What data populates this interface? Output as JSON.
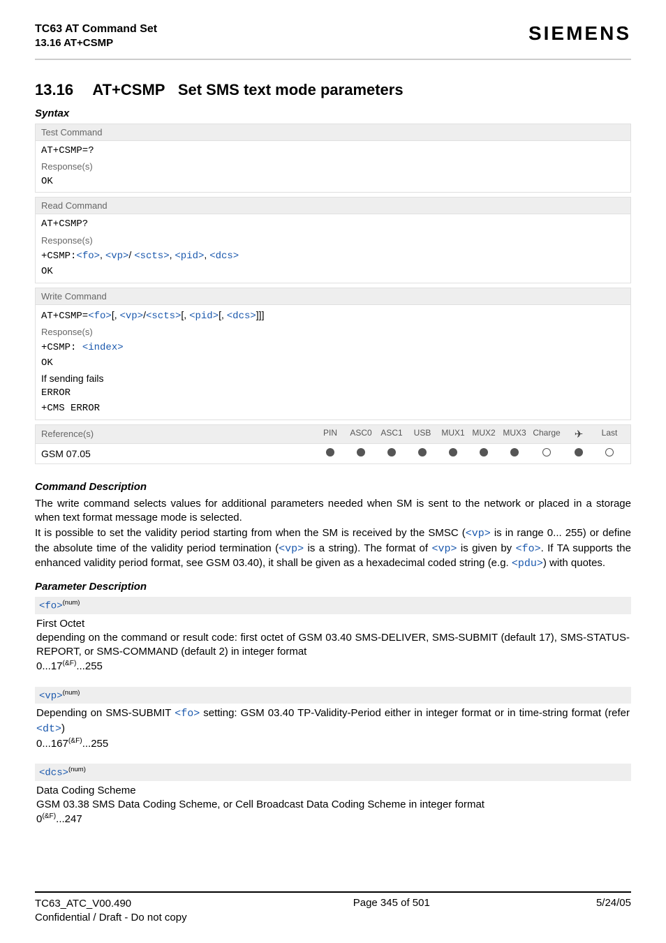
{
  "header": {
    "doc_title": "TC63 AT Command Set",
    "section_ref": "13.16 AT+CSMP",
    "brand": "SIEMENS"
  },
  "title": {
    "number": "13.16",
    "name": "AT+CSMP",
    "desc": "Set SMS text mode parameters"
  },
  "syntax": {
    "label": "Syntax",
    "test": {
      "head": "Test Command",
      "cmd": "AT+CSMP=?",
      "resp_label": "Response(s)",
      "resp": "OK"
    },
    "read": {
      "head": "Read Command",
      "cmd": "AT+CSMP?",
      "resp_label": "Response(s)",
      "resp_prefix": "+CSMP:",
      "p_fo": "<fo>",
      "p_vp": "<vp>",
      "p_scts": "<scts>",
      "p_pid": "<pid>",
      "p_dcs": "<dcs>",
      "resp_ok": "OK"
    },
    "write": {
      "head": "Write Command",
      "cmd_prefix": "AT+CSMP=",
      "p_fo": "<fo>",
      "p_vp": "<vp>",
      "p_scts": "<scts>",
      "p_pid": "<pid>",
      "p_dcs": "<dcs>",
      "resp_label": "Response(s)",
      "resp_line1a": "+CSMP: ",
      "resp_line1b": "<index>",
      "resp_ok": "OK",
      "fail_label": "If sending fails",
      "resp_error": "ERROR",
      "resp_cms": "+CMS ERROR"
    },
    "ref": {
      "head": "Reference(s)",
      "cols": [
        "PIN",
        "ASC0",
        "ASC1",
        "USB",
        "MUX1",
        "MUX2",
        "MUX3",
        "Charge",
        "✈",
        "Last"
      ],
      "label": "GSM 07.05",
      "states": [
        "filled",
        "filled",
        "filled",
        "filled",
        "filled",
        "filled",
        "filled",
        "empty",
        "filled",
        "empty"
      ]
    }
  },
  "cmd_desc": {
    "head": "Command Description",
    "p1": "The write command selects values for additional parameters needed when SM is sent to the network or placed in a storage when text format message mode is selected.",
    "p2a": "It is possible to set the validity period starting from when the SM is received by the SMSC (",
    "p2_vp1": "<vp>",
    "p2b": " is in range 0... 255) or define the absolute time of the validity period termination (",
    "p2_vp2": "<vp>",
    "p2c": " is a string). The format of ",
    "p2_vp3": "<vp>",
    "p2d": " is given by ",
    "p2_fo": "<fo>",
    "p2e": ". If TA supports the enhanced validity period format, see GSM 03.40), it shall be given as a hexadecimal coded string (e.g. ",
    "p2_pdu": "<pdu>",
    "p2f": ") with quotes."
  },
  "param_desc": {
    "head": "Parameter Description",
    "fo": {
      "tag": "<fo>",
      "sup": "(num)",
      "title": "First Octet",
      "body": "depending on the command or result code: first octet of GSM 03.40 SMS-DELIVER, SMS-SUBMIT (default 17), SMS-STATUS-REPORT, or SMS-COMMAND (default 2) in integer format",
      "range_a": "0...17",
      "range_sup": "(&F)",
      "range_b": "...255"
    },
    "vp": {
      "tag": "<vp>",
      "sup": "(num)",
      "body_a": "Depending on SMS-SUBMIT ",
      "body_link": "<fo>",
      "body_b": " setting: GSM 03.40 TP-Validity-Period either in integer format or in time-string format (refer ",
      "body_link2": "<dt>",
      "body_c": ")",
      "range_a": "0...167",
      "range_sup": "(&F)",
      "range_b": "...255"
    },
    "dcs": {
      "tag": "<dcs>",
      "sup": "(num)",
      "title": "Data Coding Scheme",
      "body": "GSM 03.38 SMS Data Coding Scheme, or Cell Broadcast Data Coding Scheme in integer format",
      "range_a": "0",
      "range_sup": "(&F)",
      "range_b": "...247"
    }
  },
  "footer": {
    "version": "TC63_ATC_V00.490",
    "page": "Page 345 of 501",
    "date": "5/24/05",
    "confidential": "Confidential / Draft - Do not copy"
  }
}
